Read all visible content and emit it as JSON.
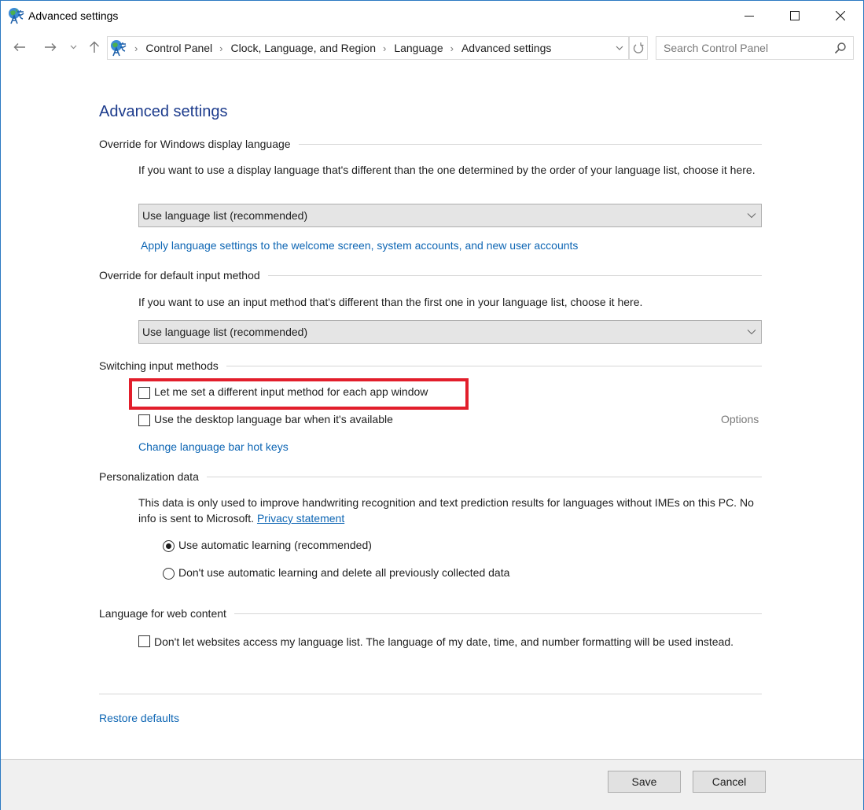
{
  "window": {
    "title": "Advanced settings",
    "controls": {
      "minimize": "minimize",
      "maximize": "maximize",
      "close": "close"
    }
  },
  "navbar": {
    "breadcrumb": [
      "Control Panel",
      "Clock, Language, and Region",
      "Language",
      "Advanced settings"
    ],
    "search_placeholder": "Search Control Panel"
  },
  "page": {
    "title": "Advanced settings",
    "sections": {
      "display_language": {
        "heading": "Override for Windows display language",
        "description": "If you want to use a display language that's different than the one determined by the order of your language list, choose it here.",
        "select_value": "Use language list (recommended)",
        "link": "Apply language settings to the welcome screen, system accounts, and new user accounts"
      },
      "input_method": {
        "heading": "Override for default input method",
        "description": "If you want to use an input method that's different than the first one in your language list, choose it here.",
        "select_value": "Use language list (recommended)"
      },
      "switching": {
        "heading": "Switching input methods",
        "checkbox_per_app": {
          "label": "Let me set a different input method for each app window",
          "checked": false,
          "highlighted": true
        },
        "checkbox_language_bar": {
          "label": "Use the desktop language bar when it's available",
          "checked": false
        },
        "options_label": "Options",
        "hotkeys_link": "Change language bar hot keys"
      },
      "personalization": {
        "heading": "Personalization data",
        "description": "This data is only used to improve handwriting recognition and text prediction results for languages without IMEs on this PC. No info is sent to Microsoft.",
        "privacy_link": "Privacy statement",
        "radio_auto": {
          "label": "Use automatic learning (recommended)",
          "selected": true
        },
        "radio_no_auto": {
          "label": "Don't use automatic learning and delete all previously collected data",
          "selected": false
        }
      },
      "web_content": {
        "heading": "Language for web content",
        "checkbox": {
          "label": "Don't let websites access my language list. The language of my date, time, and number formatting will be used instead.",
          "checked": false
        }
      }
    },
    "restore_defaults": "Restore defaults"
  },
  "footer": {
    "save": "Save",
    "cancel": "Cancel"
  },
  "colors": {
    "accent_title": "#1c3b8c",
    "link": "#0e66b4",
    "highlight_box": "#e21e2b",
    "window_border": "#2b79c2"
  }
}
